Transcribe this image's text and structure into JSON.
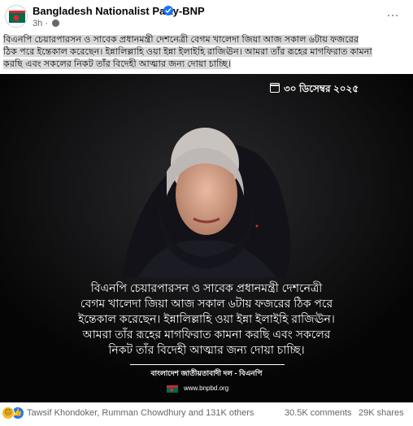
{
  "header": {
    "page_name": "Bangladesh Nationalist Party-BNP",
    "time": "3h",
    "more_label": "…"
  },
  "post": {
    "text_lines": [
      "বিএনপি চেয়ারপারসন ও সাবেক প্রধানমন্ত্রী দেশনেত্রী বেগম খালেদা জিয়া আজ সকাল ৬টায় ফজরের",
      "ঠিক পরে ইন্তেকাল করেছেন। ইন্নালিল্লাহি ওয়া ইন্না ইলাইহি রাজিঊন। আমরা তাঁর রূহের মাগফিরাত কামনা",
      "করছি এবং সকলের নিকট তাঁর বিদেহী আত্মার জন্য দোয়া চাচ্ছি।"
    ]
  },
  "image": {
    "date": "৩০ ডিসেম্বর ২০২৫",
    "caption_lines": [
      "বিএনপি চেয়ারপারসন ও সাবেক প্রধানমন্ত্রী দেশনেত্রী",
      "বেগম খালেদা জিয়া আজ সকাল ৬টায় ফজরের ঠিক পরে",
      "ইন্তেকাল করেছেন। ইন্নালিল্লাহি ওয়া ইন্না ইলাইহি রাজিঊন।",
      "আমরা তাঁর রূহের মাগফিরাত কামনা করছি এবং সকলের",
      "নিকট তাঁর বিদেহী আত্মার জন্য দোয়া চাচ্ছি।"
    ],
    "party_name": "বাংলাদেশ জাতীয়তাবাদী দল - বিএনপি",
    "url": "www.bnpbd.org"
  },
  "reactions": {
    "names": "Tawsif Khondoker, Rumman Chowdhury and 131K others",
    "comments": "30.5K comments",
    "shares": "29K shares"
  },
  "colors": {
    "verified": "#1877f2",
    "secondary_text": "#65676b",
    "image_bg": "#0b0b0b",
    "highlight": "#d9d9d9"
  },
  "icons": [
    "bnp-logo-icon",
    "verified-badge-icon",
    "globe-icon",
    "more-options-icon",
    "calendar-icon",
    "bnp-flag-icon",
    "sad-reaction-icon",
    "like-reaction-icon"
  ]
}
